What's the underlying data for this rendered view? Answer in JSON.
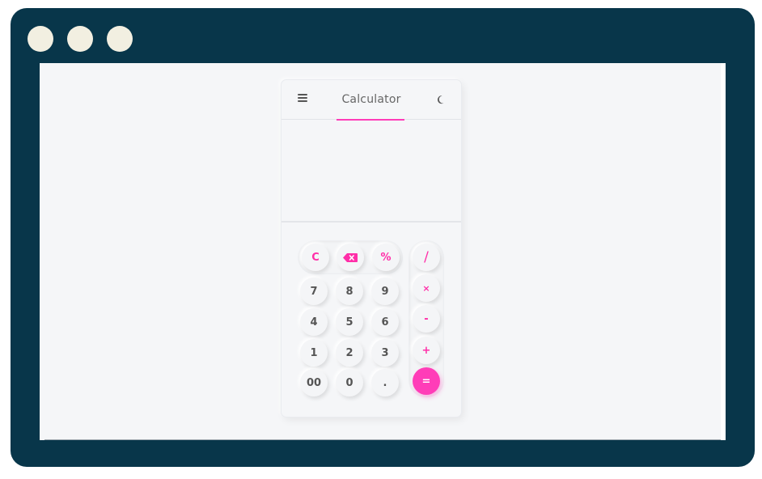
{
  "window": {
    "traffic_lights": [
      "dot-1",
      "dot-2",
      "dot-3"
    ]
  },
  "app": {
    "title": "Calculator",
    "menu_icon": "hamburger-menu-icon",
    "theme_icon": "moon-icon",
    "display_value": "",
    "accent_color": "#ff3db8"
  },
  "keys": {
    "clear": "C",
    "backspace_icon": "backspace-icon",
    "percent": "%",
    "divide": "/",
    "multiply": "×",
    "subtract": "-",
    "add": "+",
    "equals": "=",
    "row1": [
      "7",
      "8",
      "9"
    ],
    "row2": [
      "4",
      "5",
      "6"
    ],
    "row3": [
      "1",
      "2",
      "3"
    ],
    "row4": [
      "00",
      "0",
      "."
    ]
  }
}
